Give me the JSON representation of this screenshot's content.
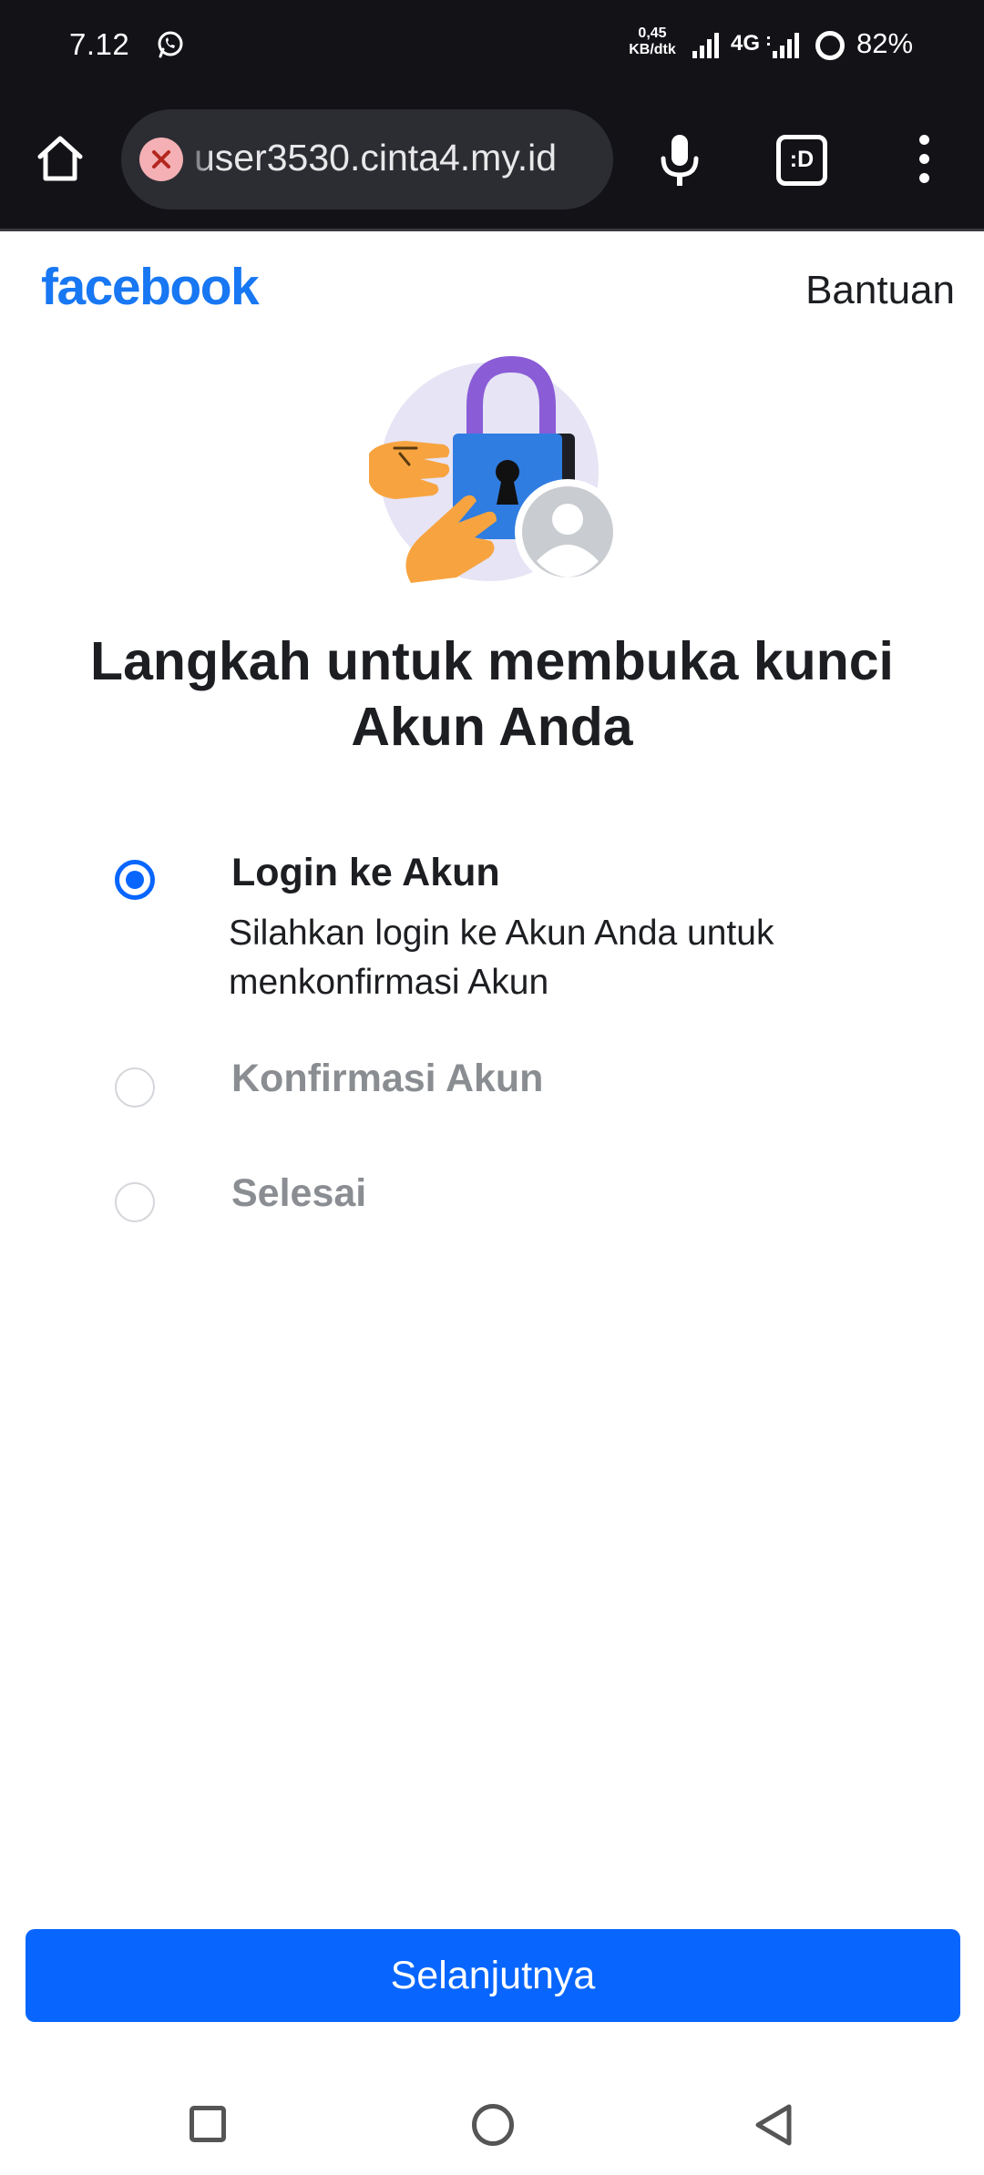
{
  "status_bar": {
    "time": "7.12",
    "net_speed_value": "0,45",
    "net_speed_unit": "KB/dtk",
    "network_type": "4G",
    "battery": "82%",
    "notification_icon": "whatsapp-icon"
  },
  "browser": {
    "url": "user3530.cinta4.my.id",
    "tab_label": ":D",
    "security_icon": "not-secure-icon"
  },
  "page": {
    "logo": "facebook",
    "help_label": "Bantuan",
    "title": "Langkah untuk membuka kunci Akun Anda",
    "steps": [
      {
        "title": "Login ke Akun",
        "description": "Silahkan login ke Akun Anda untuk menkonfirmasi Akun",
        "state": "active"
      },
      {
        "title": "Konfirmasi Akun",
        "description": "",
        "state": "pending"
      },
      {
        "title": "Selesai",
        "description": "",
        "state": "pending"
      }
    ],
    "next_button": "Selanjutnya"
  },
  "colors": {
    "brand_blue": "#1877f2",
    "button_blue": "#0866ff",
    "status_bar_bg": "#121217",
    "pending_text": "#8a8d91"
  }
}
